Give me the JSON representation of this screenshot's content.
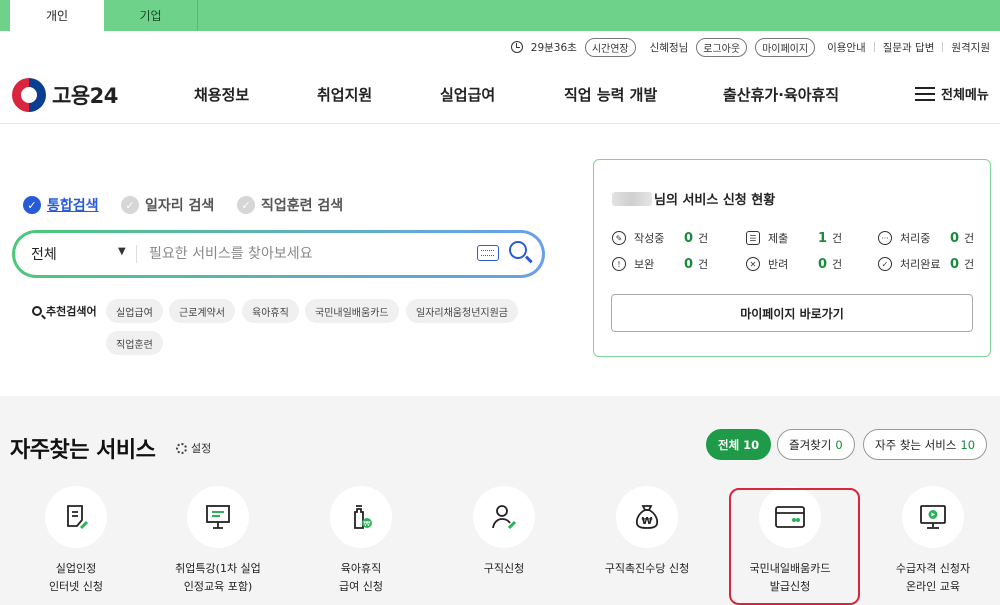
{
  "tabs": [
    {
      "label": "개인"
    },
    {
      "label": "기업"
    }
  ],
  "util": {
    "timer": "29분36초",
    "extend": "시간연장",
    "user": "신혜정님",
    "logout": "로그아웃",
    "mypage": "마이페이지",
    "guide": "이용안내",
    "faq": "질문과 답변",
    "remote": "원격지원"
  },
  "logo": {
    "text": "고용24"
  },
  "nav": [
    {
      "label": "채용정보"
    },
    {
      "label": "취업지원"
    },
    {
      "label": "실업급여"
    },
    {
      "label": "직업 능력 개발"
    },
    {
      "label": "출산휴가·육아휴직"
    }
  ],
  "menu_all": "전체메뉴",
  "search": {
    "types": [
      {
        "label": "통합검색",
        "checked": true
      },
      {
        "label": "일자리 검색",
        "checked": false
      },
      {
        "label": "직업훈련 검색",
        "checked": false
      }
    ],
    "scope": "전체",
    "placeholder": "필요한 서비스를 찾아보세요",
    "rec_label": "추천검색어",
    "recommend": [
      "실업급여",
      "근로계약서",
      "육아휴직",
      "국민내일배움카드",
      "일자리채움청년지원금",
      "직업훈련"
    ]
  },
  "status_card": {
    "title_suffix": "님의 서비스 신청 현황",
    "items": [
      {
        "label": "작성중",
        "count": "0",
        "unit": "건",
        "icon": "pencil-icon"
      },
      {
        "label": "제출",
        "count": "1",
        "unit": "건",
        "icon": "checklist-icon"
      },
      {
        "label": "처리중",
        "count": "0",
        "unit": "건",
        "icon": "dots-icon"
      },
      {
        "label": "보완",
        "count": "0",
        "unit": "건",
        "icon": "exclamation-icon"
      },
      {
        "label": "반려",
        "count": "0",
        "unit": "건",
        "icon": "x-circle-icon"
      },
      {
        "label": "처리완료",
        "count": "0",
        "unit": "건",
        "icon": "check-circle-icon"
      }
    ],
    "button": "마이페이지 바로가기"
  },
  "services": {
    "title": "자주찾는 서비스",
    "settings": "설정",
    "filters": [
      {
        "label": "전체",
        "count": "10",
        "active": true
      },
      {
        "label": "즐겨찾기",
        "count": "0",
        "active": false
      },
      {
        "label": "자주 찾는 서비스",
        "count": "10",
        "active": false
      }
    ],
    "items": [
      {
        "label": "실업인정\n인터넷 신청",
        "icon": "document-edit-icon"
      },
      {
        "label": "취업특강(1차 실업\n인정교육 포함)",
        "icon": "presentation-board-icon"
      },
      {
        "label": "육아휴직\n급여 신청",
        "icon": "baby-bottle-won-icon"
      },
      {
        "label": "구직신청",
        "icon": "person-edit-icon"
      },
      {
        "label": "구직촉진수당 신청",
        "icon": "money-bag-icon"
      },
      {
        "label": "국민내일배움카드\n발급신청",
        "icon": "card-icon"
      },
      {
        "label": "수급자격 신청자\n온라인 교육",
        "icon": "monitor-play-icon"
      }
    ]
  },
  "colors": {
    "accent_green": "#1f9a48",
    "tab_green": "#6fd28a",
    "accent_blue": "#2a5bd7",
    "highlight_red": "#d7263d"
  }
}
